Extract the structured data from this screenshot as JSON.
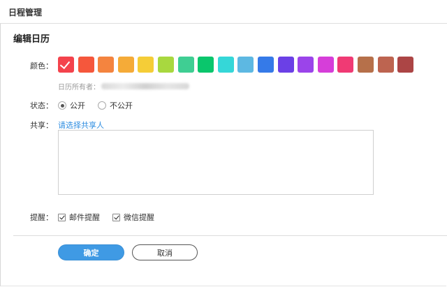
{
  "header": {
    "title": "日程管理"
  },
  "section": {
    "title": "编辑日历"
  },
  "color": {
    "label": "颜色：",
    "selected_index": 0,
    "swatches": [
      "#f4434c",
      "#f5573c",
      "#f4843f",
      "#f5ab38",
      "#f5cd37",
      "#a8d83f",
      "#3fce93",
      "#0ac66c",
      "#35d7d8",
      "#5db8e2",
      "#357ae8",
      "#6b40e6",
      "#9b44ea",
      "#d63ed9",
      "#f03a74",
      "#b6704a",
      "#bd6450",
      "#ac4545"
    ]
  },
  "owner": {
    "label": "日历所有者："
  },
  "status": {
    "label": "状态：",
    "options": [
      {
        "label": "公开",
        "checked": true
      },
      {
        "label": "不公开",
        "checked": false
      }
    ]
  },
  "share": {
    "label": "共享：",
    "link": "请选择共享人"
  },
  "reminder": {
    "label": "提醒：",
    "options": [
      {
        "label": "邮件提醒",
        "checked": true
      },
      {
        "label": "微信提醒",
        "checked": true
      }
    ]
  },
  "actions": {
    "ok": "确定",
    "cancel": "取消"
  },
  "colors": {
    "primary": "#3f9ae4",
    "link": "#2f8ee0"
  }
}
